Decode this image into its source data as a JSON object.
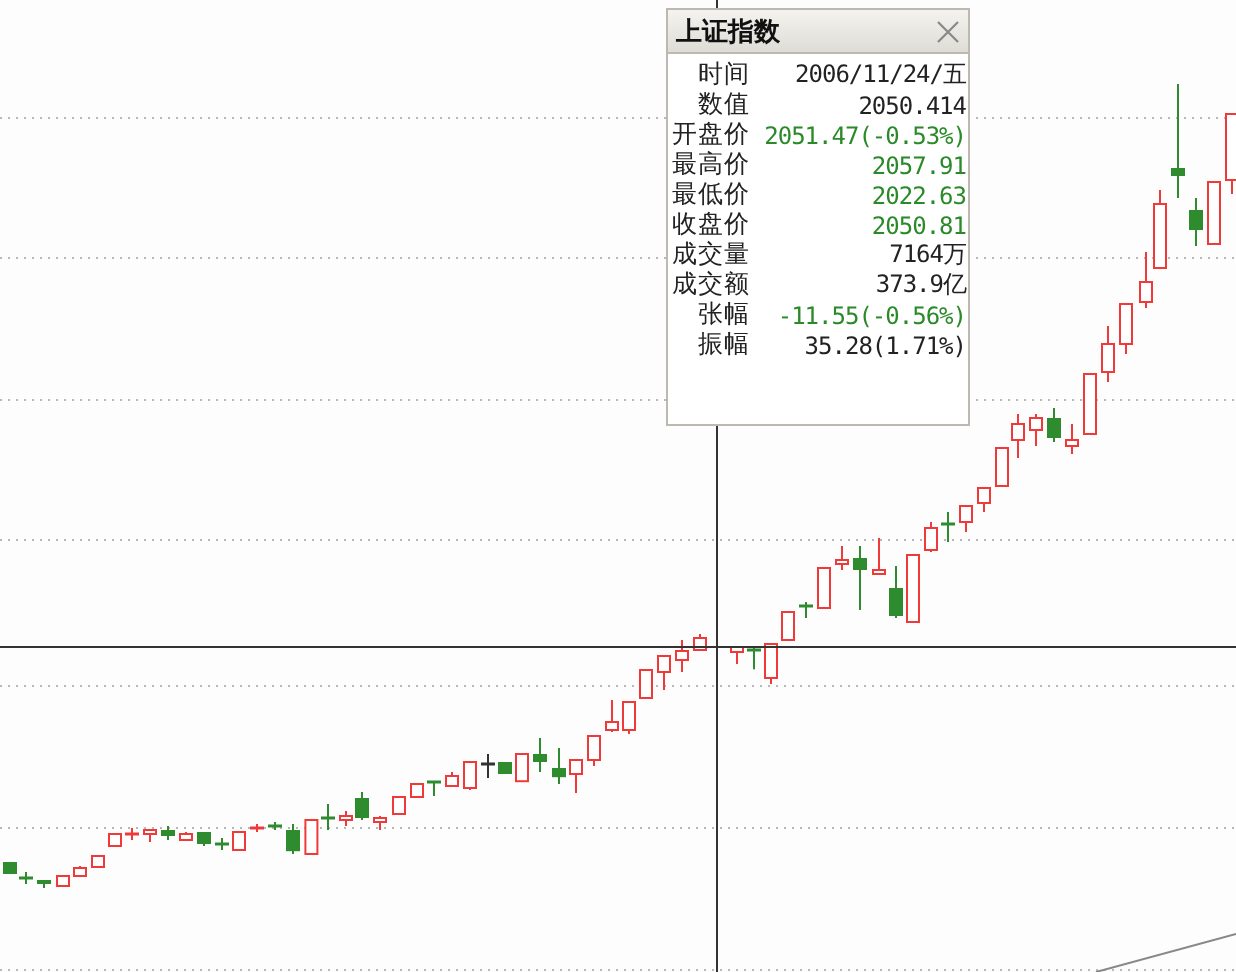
{
  "panel": {
    "title": "上证指数",
    "rows": [
      {
        "label": "时间",
        "value": "2006/11/24/五",
        "color": "#222222"
      },
      {
        "label": "数值",
        "value": "2050.414",
        "color": "#222222"
      },
      {
        "label": "开盘价",
        "value": "2051.47(-0.53%)",
        "color": "#2a8a2a"
      },
      {
        "label": "最高价",
        "value": "2057.91",
        "color": "#2a8a2a"
      },
      {
        "label": "最低价",
        "value": "2022.63",
        "color": "#2a8a2a"
      },
      {
        "label": "收盘价",
        "value": "2050.81",
        "color": "#2a8a2a"
      },
      {
        "label": "成交量",
        "value": "7164万",
        "color": "#222222"
      },
      {
        "label": "成交额",
        "value": "373.9亿",
        "color": "#222222"
      },
      {
        "label": "张幅",
        "value": "-11.55(-0.56%)",
        "color": "#2a8a2a"
      },
      {
        "label": "振幅",
        "value": "35.28(1.71%)",
        "color": "#222222"
      }
    ]
  }
}
